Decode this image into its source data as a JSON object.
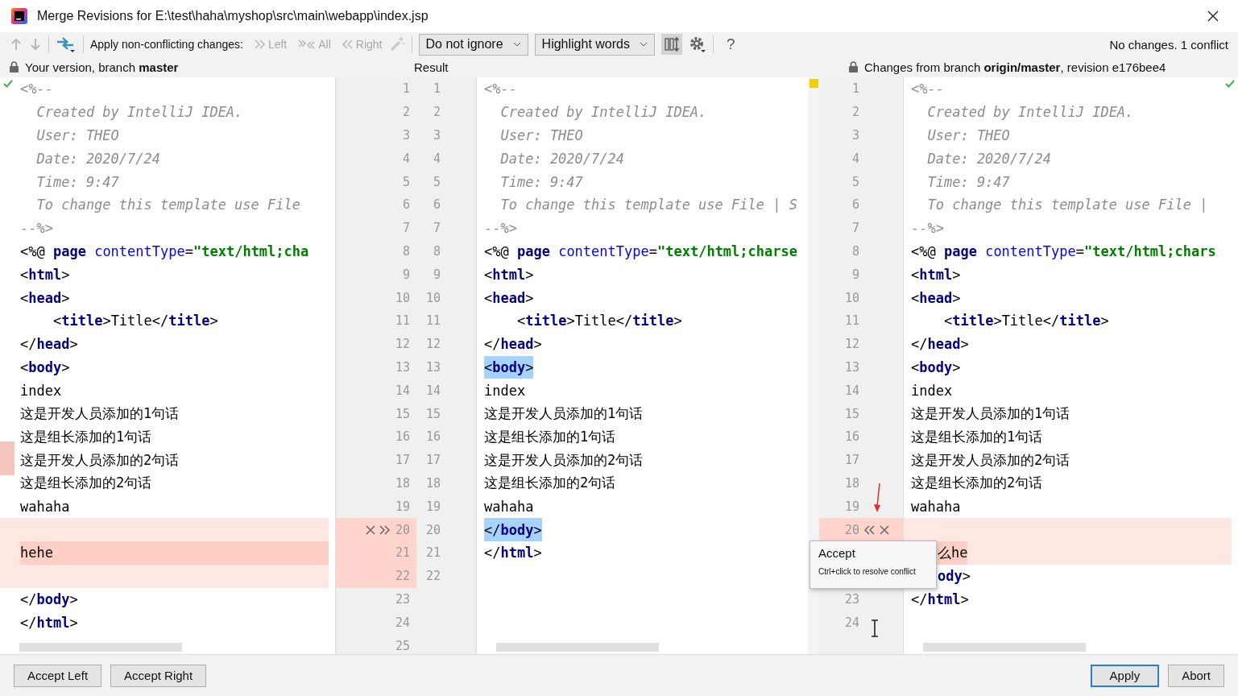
{
  "window": {
    "title": "Merge Revisions for E:\\test\\haha\\myshop\\src\\main\\webapp\\index.jsp"
  },
  "toolbar": {
    "apply_label": "Apply non-conflicting changes:",
    "apply_left": "Left",
    "apply_all": "All",
    "apply_right": "Right",
    "ignore_dropdown": "Do not ignore",
    "highlight_dropdown": "Highlight words",
    "help": "?",
    "status": "No changes. 1 conflict"
  },
  "headers": {
    "left": "Your version, branch **master**",
    "middle": "Result",
    "right": "Changes from branch **origin/master**, revision e176bee4"
  },
  "panes": [
    {
      "lines": [
        {
          "num": "1",
          "kind": "plain",
          "segs": [
            {
              "kind": "comment",
              "t": "<%--"
            }
          ]
        },
        {
          "num": "2",
          "kind": "plain",
          "segs": [
            {
              "kind": "comment",
              "t": "  Created by IntelliJ IDEA."
            }
          ]
        },
        {
          "num": "3",
          "kind": "plain",
          "segs": [
            {
              "kind": "comment",
              "t": "  User: THEO"
            }
          ]
        },
        {
          "num": "4",
          "kind": "plain",
          "segs": [
            {
              "kind": "comment",
              "t": "  Date: 2020/7/24"
            }
          ]
        },
        {
          "num": "5",
          "kind": "plain",
          "segs": [
            {
              "kind": "comment",
              "t": "  Time: 9:47"
            }
          ]
        },
        {
          "num": "6",
          "kind": "plain",
          "segs": [
            {
              "kind": "comment",
              "t": "  To change this template use File"
            }
          ]
        },
        {
          "num": "7",
          "kind": "plain",
          "segs": [
            {
              "kind": "comment",
              "t": "--%>"
            }
          ]
        },
        {
          "num": "8",
          "kind": "plain",
          "segs": [
            {
              "kind": "punct",
              "t": "<%@ "
            },
            {
              "kind": "tag",
              "t": "page"
            },
            {
              "kind": "attr",
              "t": " contentType"
            },
            {
              "kind": "punct",
              "t": "="
            },
            {
              "kind": "string",
              "t": "\"text/html;cha"
            }
          ]
        },
        {
          "num": "9",
          "kind": "plain",
          "segs": [
            {
              "kind": "punct",
              "t": "<"
            },
            {
              "kind": "tag",
              "t": "html"
            },
            {
              "kind": "punct",
              "t": ">"
            }
          ]
        },
        {
          "num": "10",
          "kind": "plain",
          "segs": [
            {
              "kind": "punct",
              "t": "<"
            },
            {
              "kind": "tag",
              "t": "head"
            },
            {
              "kind": "punct",
              "t": ">"
            }
          ]
        },
        {
          "num": "11",
          "kind": "plain",
          "segs": [
            {
              "kind": "punct",
              "t": "    <"
            },
            {
              "kind": "tag",
              "t": "title"
            },
            {
              "kind": "punct",
              "t": ">"
            },
            {
              "kind": "text",
              "t": "Title"
            },
            {
              "kind": "punct",
              "t": "</"
            },
            {
              "kind": "tag",
              "t": "title"
            },
            {
              "kind": "punct",
              "t": ">"
            }
          ]
        },
        {
          "num": "12",
          "kind": "plain",
          "segs": [
            {
              "kind": "punct",
              "t": "</"
            },
            {
              "kind": "tag",
              "t": "head"
            },
            {
              "kind": "punct",
              "t": ">"
            }
          ]
        },
        {
          "num": "13",
          "kind": "plain",
          "segs": [
            {
              "kind": "punct",
              "t": "<"
            },
            {
              "kind": "tag",
              "t": "body"
            },
            {
              "kind": "punct",
              "t": ">"
            }
          ]
        },
        {
          "num": "14",
          "kind": "plain",
          "segs": [
            {
              "kind": "text",
              "t": "index"
            }
          ]
        },
        {
          "num": "15",
          "kind": "plain",
          "segs": [
            {
              "kind": "text",
              "t": "这是开发人员添加的1句话"
            }
          ]
        },
        {
          "num": "16",
          "kind": "plain",
          "segs": [
            {
              "kind": "text",
              "t": "这是组长添加的1句话"
            }
          ]
        },
        {
          "num": "17",
          "kind": "plain",
          "segs": [
            {
              "kind": "text",
              "t": "这是开发人员添加的2句话"
            }
          ]
        },
        {
          "num": "18",
          "kind": "plain",
          "segs": [
            {
              "kind": "text",
              "t": "这是组长添加的2句话"
            }
          ]
        },
        {
          "num": "19",
          "kind": "plain",
          "segs": [
            {
              "kind": "text",
              "t": "wahaha"
            }
          ]
        },
        {
          "num": "20",
          "kind": "conflict",
          "actions": true
        },
        {
          "num": "21",
          "kind": "changed",
          "segs": [
            {
              "kind": "text",
              "t": "hehe"
            }
          ]
        },
        {
          "num": "22",
          "kind": "conflict"
        },
        {
          "num": "23",
          "kind": "plain",
          "segs": [
            {
              "kind": "punct",
              "t": "</"
            },
            {
              "kind": "tag",
              "t": "body"
            },
            {
              "kind": "punct",
              "t": ">"
            }
          ]
        },
        {
          "num": "24",
          "kind": "plain",
          "segs": [
            {
              "kind": "punct",
              "t": "</"
            },
            {
              "kind": "tag",
              "t": "html"
            },
            {
              "kind": "punct",
              "t": ">"
            }
          ]
        },
        {
          "num": "25",
          "kind": "plain"
        }
      ]
    },
    {
      "lines": [
        {
          "num": "1",
          "kind": "plain",
          "segs": [
            {
              "kind": "comment",
              "t": "<%--"
            }
          ]
        },
        {
          "num": "2",
          "kind": "plain",
          "segs": [
            {
              "kind": "comment",
              "t": "  Created by IntelliJ IDEA."
            }
          ]
        },
        {
          "num": "3",
          "kind": "plain",
          "segs": [
            {
              "kind": "comment",
              "t": "  User: THEO"
            }
          ]
        },
        {
          "num": "4",
          "kind": "plain",
          "segs": [
            {
              "kind": "comment",
              "t": "  Date: 2020/7/24"
            }
          ]
        },
        {
          "num": "5",
          "kind": "plain",
          "segs": [
            {
              "kind": "comment",
              "t": "  Time: 9:47"
            }
          ]
        },
        {
          "num": "6",
          "kind": "plain",
          "segs": [
            {
              "kind": "comment",
              "t": "  To change this template use File | S"
            }
          ]
        },
        {
          "num": "7",
          "kind": "plain",
          "segs": [
            {
              "kind": "comment",
              "t": "--%>"
            }
          ]
        },
        {
          "num": "8",
          "kind": "plain",
          "segs": [
            {
              "kind": "punct",
              "t": "<%@ "
            },
            {
              "kind": "tag",
              "t": "page"
            },
            {
              "kind": "attr",
              "t": " contentType"
            },
            {
              "kind": "punct",
              "t": "="
            },
            {
              "kind": "string",
              "t": "\"text/html;charse"
            }
          ]
        },
        {
          "num": "9",
          "kind": "plain",
          "segs": [
            {
              "kind": "punct",
              "t": "<"
            },
            {
              "kind": "tag",
              "t": "html"
            },
            {
              "kind": "punct",
              "t": ">"
            }
          ]
        },
        {
          "num": "10",
          "kind": "plain",
          "segs": [
            {
              "kind": "punct",
              "t": "<"
            },
            {
              "kind": "tag",
              "t": "head"
            },
            {
              "kind": "punct",
              "t": ">"
            }
          ]
        },
        {
          "num": "11",
          "kind": "plain",
          "segs": [
            {
              "kind": "punct",
              "t": "    <"
            },
            {
              "kind": "tag",
              "t": "title"
            },
            {
              "kind": "punct",
              "t": ">"
            },
            {
              "kind": "text",
              "t": "Title"
            },
            {
              "kind": "punct",
              "t": "</"
            },
            {
              "kind": "tag",
              "t": "title"
            },
            {
              "kind": "punct",
              "t": ">"
            }
          ]
        },
        {
          "num": "12",
          "kind": "plain",
          "segs": [
            {
              "kind": "punct",
              "t": "</"
            },
            {
              "kind": "tag",
              "t": "head"
            },
            {
              "kind": "punct",
              "t": ">"
            }
          ]
        },
        {
          "num": "13",
          "kind": "selected",
          "segs": [
            {
              "kind": "punct",
              "t": "<"
            },
            {
              "kind": "tag",
              "t": "body"
            },
            {
              "kind": "punct",
              "t": ">"
            }
          ]
        },
        {
          "num": "14",
          "kind": "plain",
          "segs": [
            {
              "kind": "text",
              "t": "index"
            }
          ]
        },
        {
          "num": "15",
          "kind": "plain",
          "segs": [
            {
              "kind": "text",
              "t": "这是开发人员添加的1句话"
            }
          ]
        },
        {
          "num": "16",
          "kind": "plain",
          "segs": [
            {
              "kind": "text",
              "t": "这是组长添加的1句话"
            }
          ]
        },
        {
          "num": "17",
          "kind": "plain",
          "segs": [
            {
              "kind": "text",
              "t": "这是开发人员添加的2句话"
            }
          ]
        },
        {
          "num": "18",
          "kind": "plain",
          "segs": [
            {
              "kind": "text",
              "t": "这是组长添加的2句话"
            }
          ]
        },
        {
          "num": "19",
          "kind": "plain",
          "segs": [
            {
              "kind": "text",
              "t": "wahaha"
            }
          ]
        },
        {
          "num": "20",
          "kind": "selected",
          "segs": [
            {
              "kind": "punct",
              "t": "</"
            },
            {
              "kind": "tag",
              "t": "body"
            },
            {
              "kind": "punct",
              "t": ">"
            }
          ]
        },
        {
          "num": "21",
          "kind": "plain",
          "segs": [
            {
              "kind": "punct",
              "t": "</"
            },
            {
              "kind": "tag",
              "t": "html"
            },
            {
              "kind": "punct",
              "t": ">"
            }
          ]
        },
        {
          "num": "22",
          "kind": "plain"
        }
      ]
    },
    {
      "lines": [
        {
          "num": "1",
          "kind": "plain",
          "segs": [
            {
              "kind": "comment",
              "t": "<%--"
            }
          ]
        },
        {
          "num": "2",
          "kind": "plain",
          "segs": [
            {
              "kind": "comment",
              "t": "  Created by IntelliJ IDEA."
            }
          ]
        },
        {
          "num": "3",
          "kind": "plain",
          "segs": [
            {
              "kind": "comment",
              "t": "  User: THEO"
            }
          ]
        },
        {
          "num": "4",
          "kind": "plain",
          "segs": [
            {
              "kind": "comment",
              "t": "  Date: 2020/7/24"
            }
          ]
        },
        {
          "num": "5",
          "kind": "plain",
          "segs": [
            {
              "kind": "comment",
              "t": "  Time: 9:47"
            }
          ]
        },
        {
          "num": "6",
          "kind": "plain",
          "segs": [
            {
              "kind": "comment",
              "t": "  To change this template use File |"
            }
          ]
        },
        {
          "num": "7",
          "kind": "plain",
          "segs": [
            {
              "kind": "comment",
              "t": "--%>"
            }
          ]
        },
        {
          "num": "8",
          "kind": "plain",
          "segs": [
            {
              "kind": "punct",
              "t": "<%@ "
            },
            {
              "kind": "tag",
              "t": "page"
            },
            {
              "kind": "attr",
              "t": " contentType"
            },
            {
              "kind": "punct",
              "t": "="
            },
            {
              "kind": "string",
              "t": "\"text/html;chars"
            }
          ]
        },
        {
          "num": "9",
          "kind": "plain",
          "segs": [
            {
              "kind": "punct",
              "t": "<"
            },
            {
              "kind": "tag",
              "t": "html"
            },
            {
              "kind": "punct",
              "t": ">"
            }
          ]
        },
        {
          "num": "10",
          "kind": "plain",
          "segs": [
            {
              "kind": "punct",
              "t": "<"
            },
            {
              "kind": "tag",
              "t": "head"
            },
            {
              "kind": "punct",
              "t": ">"
            }
          ]
        },
        {
          "num": "11",
          "kind": "plain",
          "segs": [
            {
              "kind": "punct",
              "t": "    <"
            },
            {
              "kind": "tag",
              "t": "title"
            },
            {
              "kind": "punct",
              "t": ">"
            },
            {
              "kind": "text",
              "t": "Title"
            },
            {
              "kind": "punct",
              "t": "</"
            },
            {
              "kind": "tag",
              "t": "title"
            },
            {
              "kind": "punct",
              "t": ">"
            }
          ]
        },
        {
          "num": "12",
          "kind": "plain",
          "segs": [
            {
              "kind": "punct",
              "t": "</"
            },
            {
              "kind": "tag",
              "t": "head"
            },
            {
              "kind": "punct",
              "t": ">"
            }
          ]
        },
        {
          "num": "13",
          "kind": "plain",
          "segs": [
            {
              "kind": "punct",
              "t": "<"
            },
            {
              "kind": "tag",
              "t": "body"
            },
            {
              "kind": "punct",
              "t": ">"
            }
          ]
        },
        {
          "num": "14",
          "kind": "plain",
          "segs": [
            {
              "kind": "text",
              "t": "index"
            }
          ]
        },
        {
          "num": "15",
          "kind": "plain",
          "segs": [
            {
              "kind": "text",
              "t": "这是开发人员添加的1句话"
            }
          ]
        },
        {
          "num": "16",
          "kind": "plain",
          "segs": [
            {
              "kind": "text",
              "t": "这是组长添加的1句话"
            }
          ]
        },
        {
          "num": "17",
          "kind": "plain",
          "segs": [
            {
              "kind": "text",
              "t": "这是开发人员添加的2句话"
            }
          ]
        },
        {
          "num": "18",
          "kind": "plain",
          "segs": [
            {
              "kind": "text",
              "t": "这是组长添加的2句话"
            }
          ]
        },
        {
          "num": "19",
          "kind": "plain",
          "segs": [
            {
              "kind": "text",
              "t": "wahaha"
            }
          ]
        },
        {
          "num": "20",
          "kind": "conflict",
          "actions": true
        },
        {
          "kind": "changed",
          "covered": true,
          "segs": [
            {
              "kind": "text",
              "t": "么he"
            }
          ]
        },
        {
          "kind": "plain",
          "covered": true,
          "segs": [
            {
              "kind": "tag",
              "t": "ody"
            },
            {
              "kind": "punct",
              "t": ">"
            }
          ]
        },
        {
          "num": "23",
          "kind": "plain",
          "segs": [
            {
              "kind": "punct",
              "t": "</"
            },
            {
              "kind": "tag",
              "t": "html"
            },
            {
              "kind": "punct",
              "t": ">"
            }
          ]
        },
        {
          "num": "24",
          "kind": "plain"
        }
      ]
    }
  ],
  "tooltip": {
    "title": "Accept",
    "hint": "Ctrl+click to resolve conflict"
  },
  "buttons": [
    {
      "label": "Accept Left",
      "kind": "normal"
    },
    {
      "label": "Accept Right",
      "kind": "normal"
    },
    {
      "label": "Apply",
      "kind": "default"
    },
    {
      "label": "Abort",
      "kind": "normal"
    }
  ]
}
